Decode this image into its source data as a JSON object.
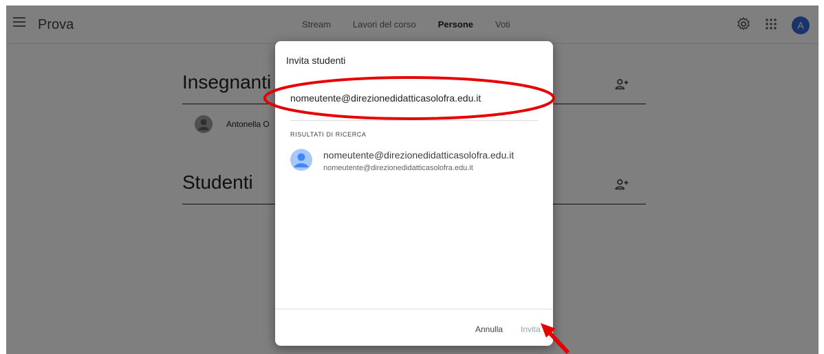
{
  "header": {
    "title": "Prova",
    "tabs": [
      {
        "label": "Stream"
      },
      {
        "label": "Lavori del corso"
      },
      {
        "label": "Persone"
      },
      {
        "label": "Voti"
      }
    ],
    "avatar_letter": "A"
  },
  "content": {
    "teachers_title": "Insegnanti",
    "teacher_name": "Antonella O",
    "students_title": "Studenti"
  },
  "dialog": {
    "title": "Invita studenti",
    "input_value": "nomeutente@direzionedidatticasolofra.edu.it",
    "results_label": "RISULTATI DI RICERCA",
    "result": {
      "name": "nomeutente@direzionedidatticasolofra.edu.it",
      "email": "nomeutente@direzionedidatticasolofra.edu.it"
    },
    "cancel_label": "Annulla",
    "invite_label": "Invita"
  },
  "colors": {
    "accent": "#3367d6",
    "annotation": "#e60000"
  }
}
